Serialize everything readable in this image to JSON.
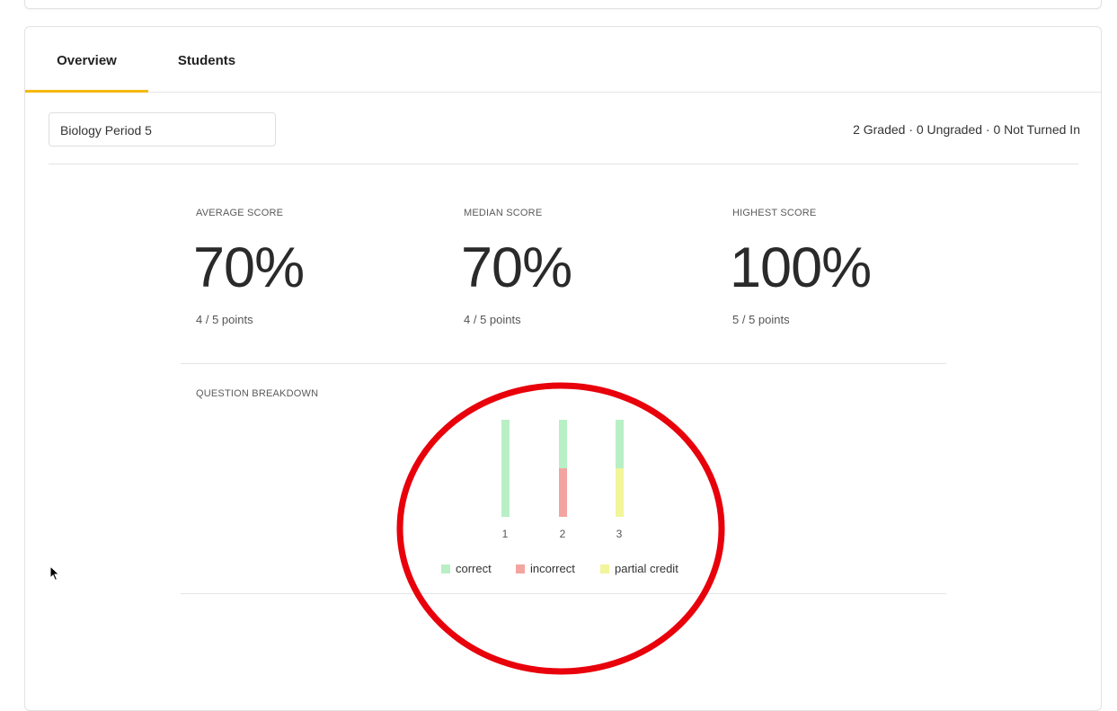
{
  "tabs": [
    {
      "label": "Overview",
      "active": true
    },
    {
      "label": "Students",
      "active": false
    }
  ],
  "filter": {
    "class_name": "Biology Period 5"
  },
  "grading_status": "2 Graded · 0 Ungraded · 0 Not Turned In",
  "stats": [
    {
      "label": "AVERAGE SCORE",
      "value": "70%",
      "points": "4 / 5 points"
    },
    {
      "label": "MEDIAN SCORE",
      "value": "70%",
      "points": "4 / 5 points"
    },
    {
      "label": "HIGHEST SCORE",
      "value": "100%",
      "points": "5 / 5 points"
    }
  ],
  "breakdown": {
    "title": "QUESTION BREAKDOWN",
    "questions": [
      {
        "label": "1",
        "correct": 1.0,
        "incorrect": 0.0,
        "partial": 0.0
      },
      {
        "label": "2",
        "correct": 0.5,
        "incorrect": 0.5,
        "partial": 0.0
      },
      {
        "label": "3",
        "correct": 0.5,
        "incorrect": 0.0,
        "partial": 0.5
      }
    ],
    "legend": [
      {
        "key": "correct",
        "label": "correct",
        "color": "#b9efc5"
      },
      {
        "key": "incorrect",
        "label": "incorrect",
        "color": "#f4a4a0"
      },
      {
        "key": "partial",
        "label": "partial credit",
        "color": "#f2f59a"
      }
    ]
  },
  "colors": {
    "tab_accent": "#f5b90f",
    "annotation_circle": "#e8000b"
  }
}
